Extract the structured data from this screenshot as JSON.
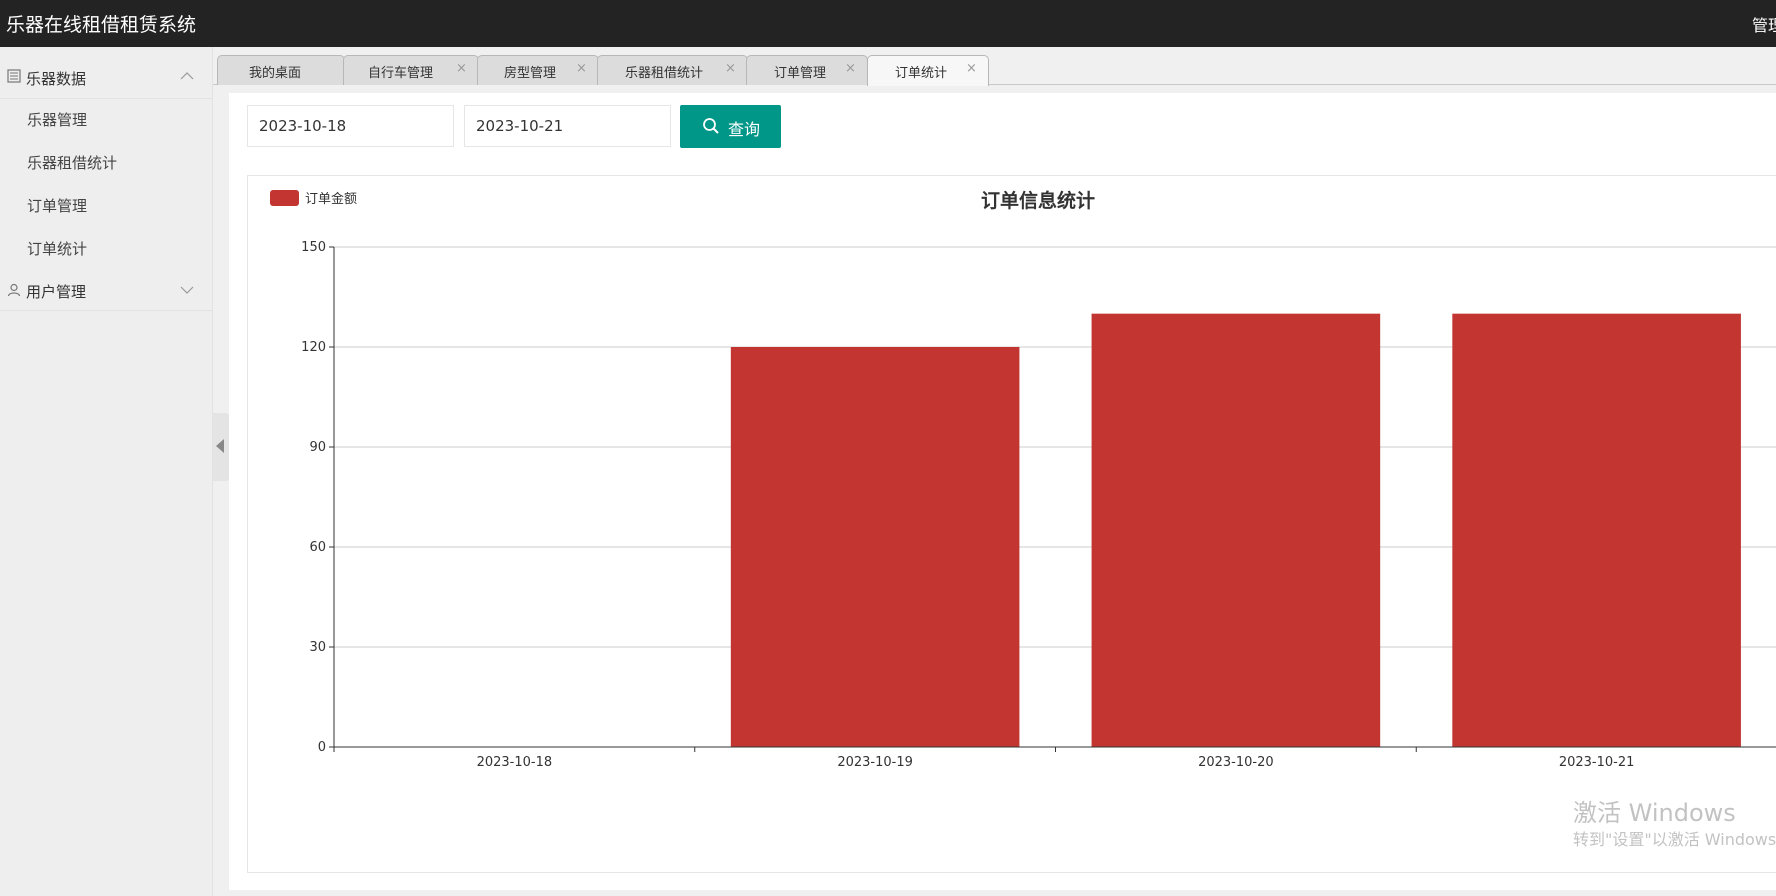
{
  "header": {
    "title": "乐器在线租借租赁系统",
    "admin_label": "管理"
  },
  "sidebar": {
    "groups": [
      {
        "label": "乐器数据",
        "icon": "list-icon",
        "expanded": true,
        "items": [
          {
            "label": "乐器管理"
          },
          {
            "label": "乐器租借统计"
          },
          {
            "label": "订单管理"
          },
          {
            "label": "订单统计"
          }
        ]
      },
      {
        "label": "用户管理",
        "icon": "user-icon",
        "expanded": false
      }
    ]
  },
  "tabs": [
    {
      "label": "我的桌面",
      "closable": false
    },
    {
      "label": "自行车管理",
      "closable": true
    },
    {
      "label": "房型管理",
      "closable": true
    },
    {
      "label": "乐器租借统计",
      "closable": true
    },
    {
      "label": "订单管理",
      "closable": true
    },
    {
      "label": "订单统计",
      "closable": true,
      "active": true
    }
  ],
  "close_glyph": "×",
  "filters": {
    "start_date": "2023-10-18",
    "end_date": "2023-10-21",
    "query_label": "查询"
  },
  "colors": {
    "accent": "#009688",
    "bar": "#c23531"
  },
  "chart_data": {
    "type": "bar",
    "title": "订单信息统计",
    "categories": [
      "2023-10-18",
      "2023-10-19",
      "2023-10-20",
      "2023-10-21"
    ],
    "series": [
      {
        "name": "订单金额",
        "values": [
          0,
          120,
          130,
          130
        ]
      }
    ],
    "ylim": [
      0,
      150
    ],
    "yticks": [
      0,
      30,
      60,
      90,
      120,
      150
    ],
    "grid": true,
    "legend": "top-left"
  },
  "watermark": {
    "line1": "激活 Windows",
    "line2": "转到\"设置\"以激活 Windows。"
  }
}
